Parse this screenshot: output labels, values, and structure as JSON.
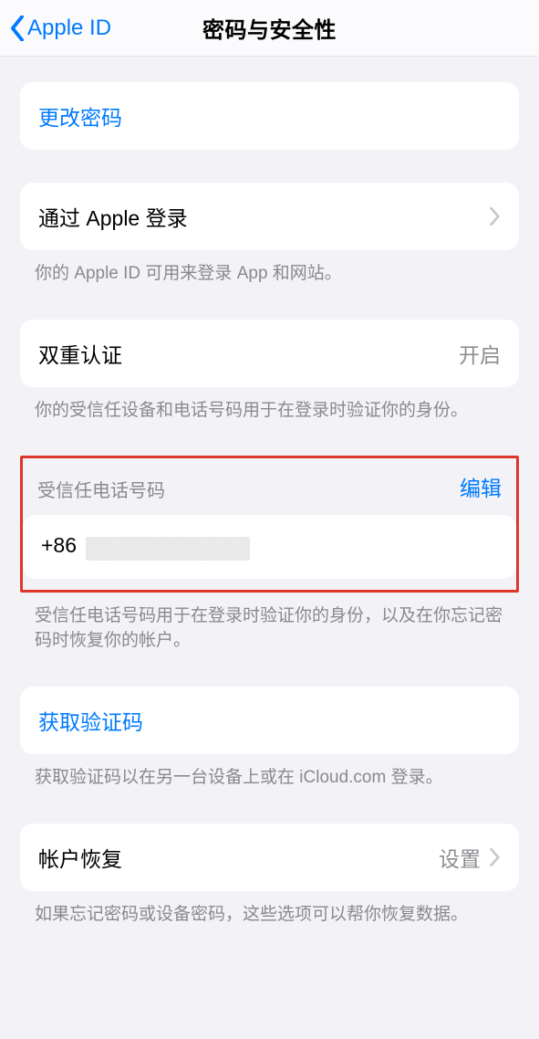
{
  "colors": {
    "accent": "#007aff",
    "highlight": "#e0352b",
    "bg": "#f2f2f7",
    "secondary": "#8a8a8e"
  },
  "nav": {
    "back_label": "Apple ID",
    "title": "密码与安全性"
  },
  "change_password": {
    "label": "更改密码"
  },
  "sign_in_with_apple": {
    "label": "通过 Apple 登录",
    "footer": "你的 Apple ID 可用来登录 App 和网站。"
  },
  "two_factor": {
    "label": "双重认证",
    "value": "开启",
    "footer": "你的受信任设备和电话号码用于在登录时验证你的身份。"
  },
  "trusted_phone": {
    "header": "受信任电话号码",
    "edit": "编辑",
    "prefix": "+86",
    "footer": "受信任电话号码用于在登录时验证你的身份，以及在你忘记密码时恢复你的帐户。"
  },
  "get_code": {
    "label": "获取验证码",
    "footer": "获取验证码以在另一台设备上或在 iCloud.com 登录。"
  },
  "account_recovery": {
    "label": "帐户恢复",
    "value": "设置",
    "footer": "如果忘记密码或设备密码，这些选项可以帮你恢复数据。"
  }
}
